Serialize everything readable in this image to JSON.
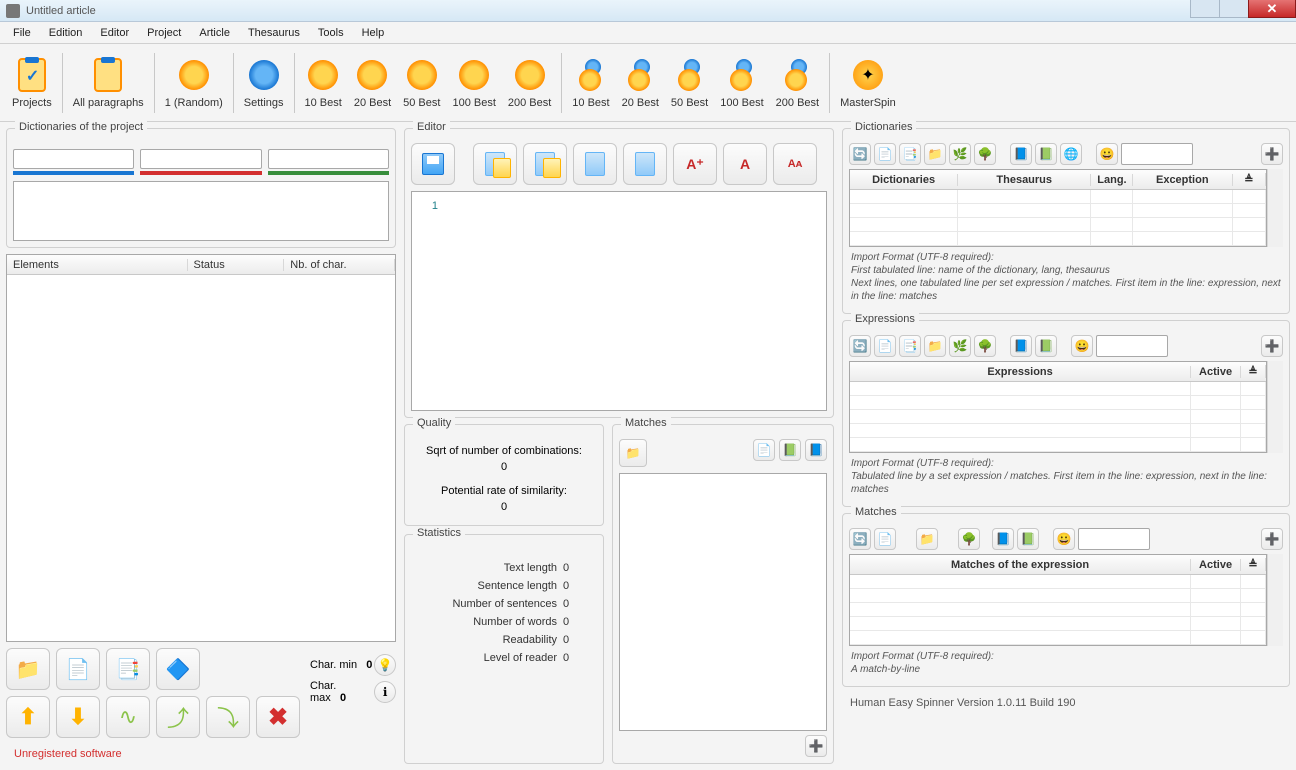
{
  "titlebar": {
    "title": "Untitled article"
  },
  "menu": [
    "File",
    "Edition",
    "Editor",
    "Project",
    "Article",
    "Thesaurus",
    "Tools",
    "Help"
  ],
  "toolbar": {
    "projects": "Projects",
    "all_paragraphs": "All paragraphs",
    "random": "1 (Random)",
    "settings": "Settings",
    "best10": "10 Best",
    "best20": "20 Best",
    "best50": "50 Best",
    "best100": "100 Best",
    "best200": "200 Best",
    "mix10": "10 Best",
    "mix20": "20 Best",
    "mix50": "50 Best",
    "mix100": "100 Best",
    "mix200": "200 Best",
    "masterspin": "MasterSpin"
  },
  "left": {
    "dict_title": "Dictionaries of the project",
    "elements_hdr": "Elements",
    "status_hdr": "Status",
    "nbchar_hdr": "Nb. of char.",
    "char_min_lbl": "Char. min",
    "char_min_val": "0",
    "char_max_lbl": "Char. max",
    "char_max_val": "0",
    "unregistered": "Unregistered software"
  },
  "mid": {
    "editor_title": "Editor",
    "line_num": "1",
    "quality_title": "Quality",
    "sqrt_lbl": "Sqrt of number of combinations:",
    "sqrt_val": "0",
    "potential_lbl": "Potential rate of similarity:",
    "potential_val": "0",
    "stats_title": "Statistics",
    "stat_text_length": "Text length",
    "stat_sentence_length": "Sentence length",
    "stat_num_sentences": "Number of sentences",
    "stat_num_words": "Number of words",
    "stat_readability": "Readability",
    "stat_level": "Level of reader",
    "stat_val_zero": "0",
    "matches_title": "Matches"
  },
  "right": {
    "dict_title": "Dictionaries",
    "dict_hdr_dict": "Dictionaries",
    "dict_hdr_thes": "Thesaurus",
    "dict_hdr_lang": "Lang.",
    "dict_hdr_exc": "Exception",
    "dict_hint": "Import Format (UTF-8 required):\nFirst tabulated line: name of the dictionary, lang, thesaurus\nNext lines, one tabulated line per set  expression / matches. First item in the line: expression, next in the line: matches",
    "expr_title": "Expressions",
    "expr_hdr_expr": "Expressions",
    "expr_hdr_active": "Active",
    "expr_hint": "Import Format (UTF-8 required):\nTabulated line by a set expression / matches. First item in the line: expression, next in the line: matches",
    "matches_title": "Matches",
    "matches_hdr": "Matches of the expression",
    "matches_hdr_active": "Active",
    "matches_hint": "Import Format (UTF-8 required):\nA match-by-line",
    "version": "Human Easy Spinner Version 1.0.11 Build 190"
  }
}
